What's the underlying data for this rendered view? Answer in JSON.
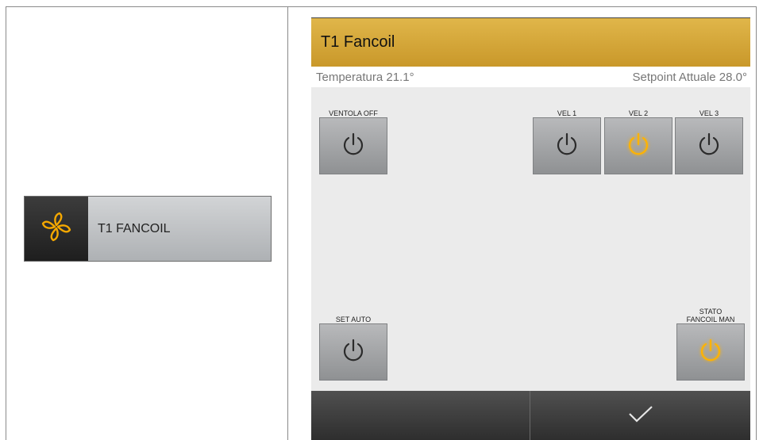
{
  "widget": {
    "label": "T1 FANCOIL",
    "icon": "fan-icon",
    "icon_color": "#f5a800"
  },
  "panel": {
    "title": "T1 Fancoil",
    "temperature": "Temperatura 21.1°",
    "setpoint": "Setpoint Attuale 28.0°",
    "controls": [
      {
        "label": "VENTOLA OFF",
        "active": false
      },
      {
        "label": "VEL 1",
        "active": false
      },
      {
        "label": "VEL 2",
        "active": true
      },
      {
        "label": "VEL 3",
        "active": false
      },
      {
        "label": "SET AUTO",
        "active": false
      },
      {
        "label": "STATO\nFANCOIL MAN",
        "active": true
      }
    ],
    "confirm_icon": "checkmark-icon"
  },
  "colors": {
    "header": "#d4a73a",
    "active_power": "#ffb300",
    "inactive_power": "#2b2b2b"
  }
}
